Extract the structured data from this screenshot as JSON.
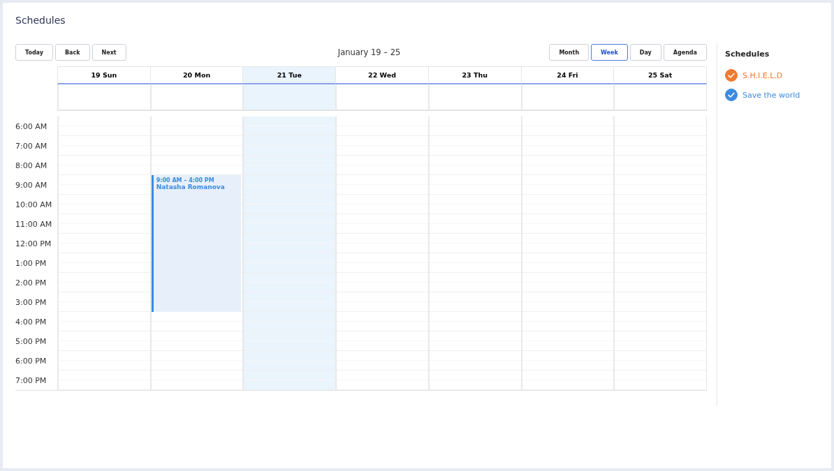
{
  "title": "Schedules",
  "nav_buttons": [
    "Today",
    "Back",
    "Next"
  ],
  "range_label": "January 19 – 25",
  "view_buttons": [
    {
      "label": "Month",
      "selected": false
    },
    {
      "label": "Week",
      "selected": true
    },
    {
      "label": "Day",
      "selected": false
    },
    {
      "label": "Agenda",
      "selected": false
    }
  ],
  "days": [
    {
      "label": "19 Sun",
      "selected": false
    },
    {
      "label": "20 Mon",
      "selected": false,
      "events": [
        {
          "time": "9:00 AM – 4:00 PM",
          "title": "Natasha Romanova",
          "color": "#3b8be0"
        }
      ]
    },
    {
      "label": "21 Tue",
      "selected": true
    },
    {
      "label": "22 Wed",
      "selected": false
    },
    {
      "label": "23 Thu",
      "selected": false
    },
    {
      "label": "24 Fri",
      "selected": false
    },
    {
      "label": "25 Sat",
      "selected": false
    }
  ],
  "time_slots": [
    "6:00 AM",
    "7:00 AM",
    "8:00 AM",
    "9:00 AM",
    "10:00 AM",
    "11:00 AM",
    "12:00 PM",
    "1:00 PM",
    "2:00 PM",
    "3:00 PM",
    "4:00 PM",
    "5:00 PM",
    "6:00 PM",
    "7:00 PM"
  ],
  "sidebar": {
    "title": "Schedules",
    "calendars": [
      {
        "name": "S.H.I.E.L.D",
        "checked": true,
        "color": "#f07a2e"
      },
      {
        "name": "Save the world",
        "checked": true,
        "color": "#3b8be0"
      }
    ]
  }
}
